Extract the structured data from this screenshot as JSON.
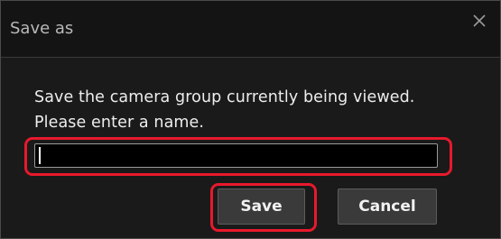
{
  "dialog": {
    "title": "Save as",
    "close_icon": "close-icon",
    "message_line1": "Save the camera group currently being viewed.",
    "message_line2": "Please enter a name.",
    "name_input": {
      "value": "",
      "placeholder": ""
    },
    "save_label": "Save",
    "cancel_label": "Cancel"
  },
  "colors": {
    "background": "#1a1a1a",
    "titlebar": "#141414",
    "input_background": "#000000",
    "button": "#3a3a3a",
    "highlight": "#e8192c"
  }
}
